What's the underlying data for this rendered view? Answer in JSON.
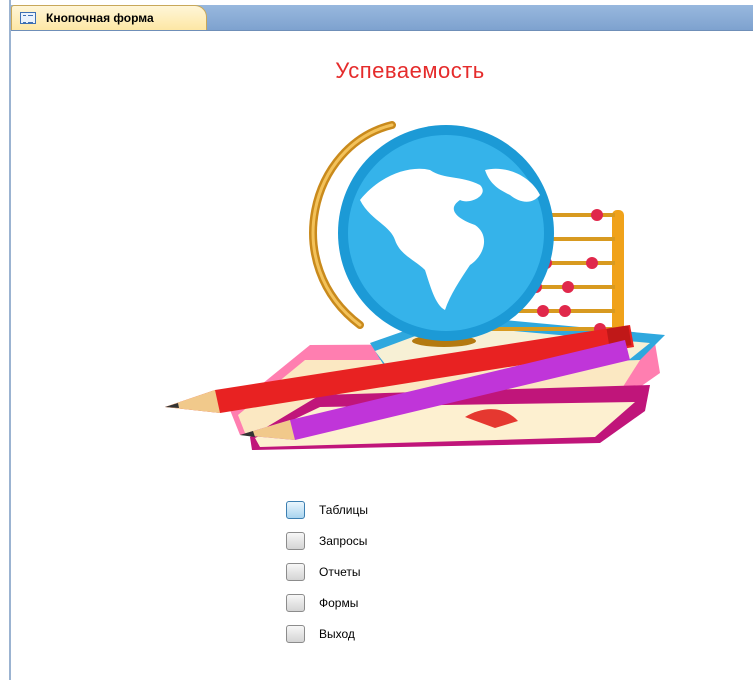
{
  "tab": {
    "label": "Кнопочная форма",
    "icon": "form-icon"
  },
  "form": {
    "title": "Успеваемость",
    "title_color": "#e52b2b"
  },
  "illustration": {
    "name": "globe-books-pencils-abacus-illustration"
  },
  "menu": {
    "items": [
      {
        "label": "Таблицы",
        "active": true
      },
      {
        "label": "Запросы",
        "active": false
      },
      {
        "label": "Отчеты",
        "active": false
      },
      {
        "label": "Формы",
        "active": false
      },
      {
        "label": "Выход",
        "active": false
      }
    ]
  }
}
